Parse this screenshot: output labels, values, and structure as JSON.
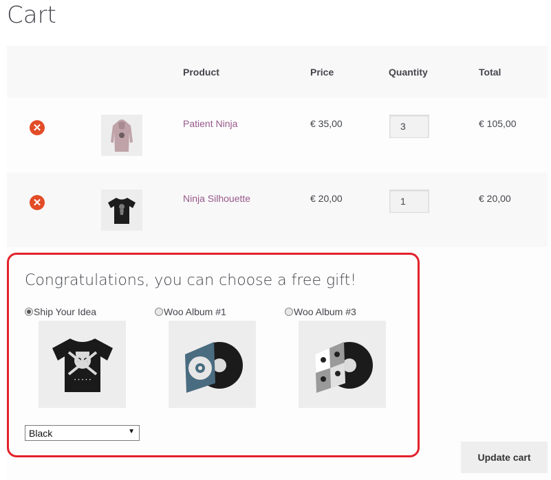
{
  "page": {
    "title": "Cart"
  },
  "table": {
    "headers": {
      "product": "Product",
      "price": "Price",
      "quantity": "Quantity",
      "total": "Total"
    },
    "rows": [
      {
        "name": "Patient Ninja",
        "price": "€ 35,00",
        "quantity": "3",
        "total": "€ 105,00",
        "thumb_icon": "hoodie-icon"
      },
      {
        "name": "Ninja Silhouette",
        "price": "€ 20,00",
        "quantity": "1",
        "total": "€ 20,00",
        "thumb_icon": "tshirt-icon"
      }
    ],
    "remove_symbol": "✕"
  },
  "gift": {
    "title": "Congratulations, you can choose a free gift!",
    "options": [
      {
        "label": "Ship Your Idea",
        "selected": true,
        "image_icon": "skull-tshirt-icon"
      },
      {
        "label": "Woo Album #1",
        "selected": false,
        "image_icon": "vinyl-album-icon"
      },
      {
        "label": "Woo Album #3",
        "selected": false,
        "image_icon": "vinyl-album-icon"
      }
    ],
    "variation_select": {
      "value": "Black"
    }
  },
  "actions": {
    "update_cart": "Update cart"
  },
  "colors": {
    "product_link": "#96588a",
    "remove": "#e24c27",
    "highlight_border": "#e3202a"
  }
}
